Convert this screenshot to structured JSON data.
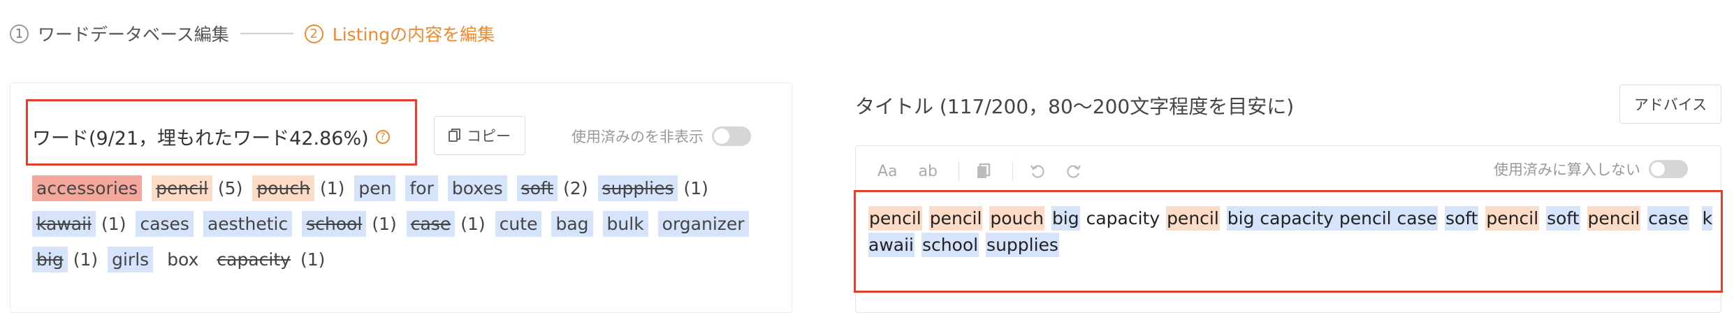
{
  "stepper": {
    "steps": [
      {
        "num": "1",
        "label": "ワードデータベース編集"
      },
      {
        "num": "2",
        "label": "Listingの内容を編集"
      }
    ]
  },
  "words": {
    "title": "ワード(9/21，埋もれたワード42.86%)",
    "help_icon": "?",
    "copy_label": "コピー",
    "hide_used_label": "使用済みのを非表示",
    "rows": [
      [
        {
          "word": "accessories",
          "count": "",
          "style": "red",
          "struck": false
        },
        {
          "word": "pencil",
          "count": "(5)",
          "style": "orange",
          "struck": true
        },
        {
          "word": "pouch",
          "count": "(1)",
          "style": "orange",
          "struck": true
        },
        {
          "word": "pen",
          "count": "",
          "style": "blue",
          "struck": false
        },
        {
          "word": "for",
          "count": "",
          "style": "blue",
          "struck": false
        },
        {
          "word": "boxes",
          "count": "",
          "style": "blue",
          "struck": false
        },
        {
          "word": "soft",
          "count": "(2)",
          "style": "blue",
          "struck": true
        },
        {
          "word": "supplies",
          "count": "(1)",
          "style": "blue",
          "struck": true
        }
      ],
      [
        {
          "word": "kawaii",
          "count": "(1)",
          "style": "blue",
          "struck": true
        },
        {
          "word": "cases",
          "count": "",
          "style": "blue",
          "struck": false
        },
        {
          "word": "aesthetic",
          "count": "",
          "style": "blue",
          "struck": false
        },
        {
          "word": "school",
          "count": "(1)",
          "style": "blue",
          "struck": true
        },
        {
          "word": "case",
          "count": "(1)",
          "style": "blue",
          "struck": true
        },
        {
          "word": "cute",
          "count": "",
          "style": "blue",
          "struck": false
        },
        {
          "word": "bag",
          "count": "",
          "style": "blue",
          "struck": false
        },
        {
          "word": "bulk",
          "count": "",
          "style": "blue",
          "struck": false
        },
        {
          "word": "organizer",
          "count": "",
          "style": "blue",
          "struck": false
        }
      ],
      [
        {
          "word": "big",
          "count": "(1)",
          "style": "blue",
          "struck": true
        },
        {
          "word": "girls",
          "count": "",
          "style": "blue",
          "struck": false
        },
        {
          "word": "box",
          "count": "",
          "style": "none",
          "struck": false
        },
        {
          "word": "capacity",
          "count": "(1)",
          "style": "none",
          "struck": true
        }
      ]
    ]
  },
  "title_panel": {
    "heading": "タイトル (117/200，80～200文字程度を目安に)",
    "advice_label": "アドバイス",
    "toolbar": {
      "aa": "Aa",
      "ab": "ab"
    },
    "not_count_label": "使用済みに算入しない",
    "tokens": [
      {
        "t": "pencil",
        "c": "orange"
      },
      {
        "t": " ",
        "c": ""
      },
      {
        "t": "pencil",
        "c": "orange"
      },
      {
        "t": " ",
        "c": ""
      },
      {
        "t": "pouch",
        "c": "orange"
      },
      {
        "t": " ",
        "c": ""
      },
      {
        "t": "big",
        "c": "blue"
      },
      {
        "t": " capacity ",
        "c": ""
      },
      {
        "t": "pencil",
        "c": "orange"
      },
      {
        "t": " ",
        "c": ""
      },
      {
        "t": "big capacity pencil case",
        "c": "blue"
      },
      {
        "t": " ",
        "c": ""
      },
      {
        "t": "soft",
        "c": "blue"
      },
      {
        "t": " ",
        "c": ""
      },
      {
        "t": "pencil",
        "c": "orange"
      },
      {
        "t": " ",
        "c": ""
      },
      {
        "t": "soft",
        "c": "blue"
      },
      {
        "t": " ",
        "c": ""
      },
      {
        "t": "pencil",
        "c": "orange"
      },
      {
        "t": " ",
        "c": ""
      },
      {
        "t": "case",
        "c": "blue"
      },
      {
        "t": "  ",
        "c": ""
      },
      {
        "t": "kawaii",
        "c": "blue"
      },
      {
        "t": " ",
        "c": ""
      },
      {
        "t": "school",
        "c": "blue"
      },
      {
        "t": " ",
        "c": ""
      },
      {
        "t": "supplies",
        "c": "blue"
      }
    ]
  },
  "colors": {
    "accent": "#ef8a2d",
    "highlight_box": "#e0412f",
    "tag_red": "#f4a79b",
    "tag_orange": "#fcdcc6",
    "tag_blue": "#d5e3fb"
  }
}
